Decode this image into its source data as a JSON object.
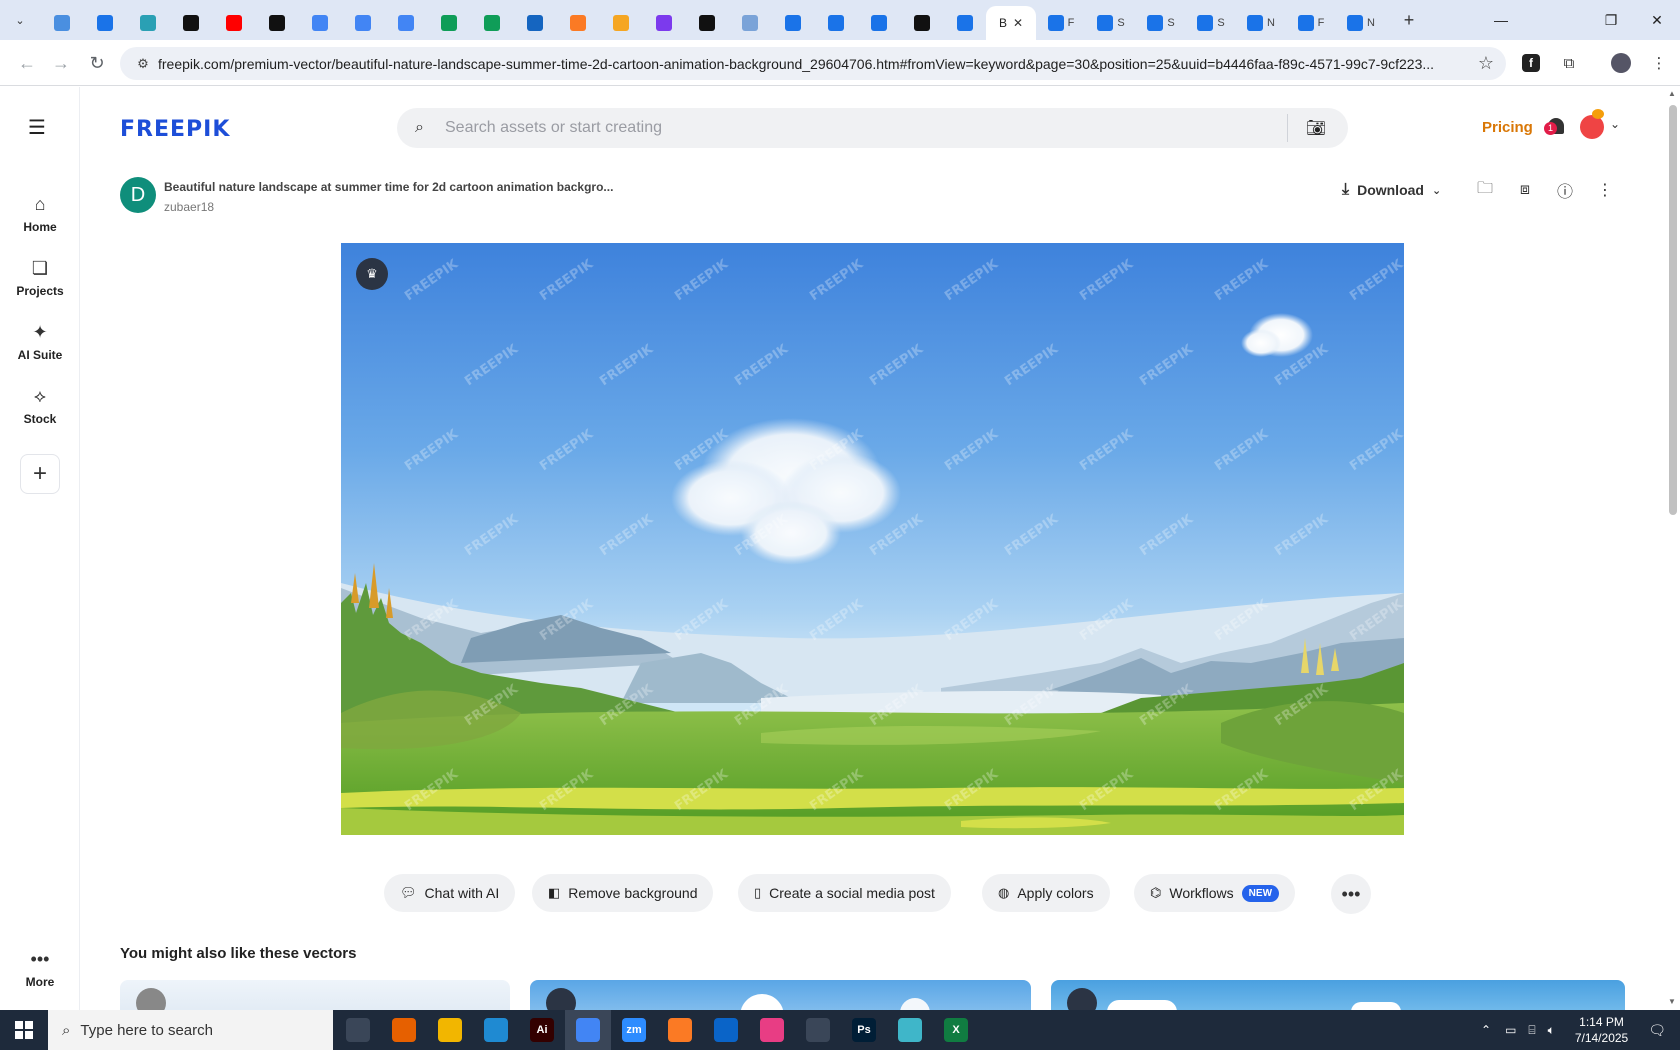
{
  "browser": {
    "tabs": [
      {
        "icon": "globe-icon",
        "color": "#4a8fe0"
      },
      {
        "icon": "shield-icon",
        "color": "#1a73e8"
      },
      {
        "icon": "play-circle-icon",
        "color": "#2aa0b4"
      },
      {
        "icon": "openai-icon",
        "color": "#111111"
      },
      {
        "icon": "youtube-icon",
        "color": "#ff0000"
      },
      {
        "icon": "bolt-icon",
        "color": "#111111"
      },
      {
        "icon": "docs-icon",
        "color": "#4285f4"
      },
      {
        "icon": "docs-icon",
        "color": "#4285f4"
      },
      {
        "icon": "docs-icon",
        "color": "#4285f4"
      },
      {
        "icon": "sheets-icon",
        "color": "#0f9d58"
      },
      {
        "icon": "sheets-icon",
        "color": "#0f9d58"
      },
      {
        "icon": "chart-icon",
        "color": "#1565c0"
      },
      {
        "icon": "xampp-icon",
        "color": "#fb7a24"
      },
      {
        "icon": "vee-icon",
        "color": "#f5a623"
      },
      {
        "icon": "braces-icon",
        "color": "#7c3aed"
      },
      {
        "icon": "artstation-icon",
        "color": "#111111"
      },
      {
        "icon": "grid-icon",
        "color": "#7aa3d8"
      },
      {
        "icon": "forms-icon",
        "color": "#1a73e8"
      },
      {
        "icon": "forms-icon",
        "color": "#1a73e8"
      },
      {
        "icon": "forms-icon",
        "color": "#1a73e8"
      },
      {
        "icon": "medium-icon",
        "color": "#111111"
      },
      {
        "icon": "forms-icon",
        "color": "#1a73e8"
      }
    ],
    "active_tab": {
      "label": "B"
    },
    "small_tabs": [
      {
        "label": "F"
      },
      {
        "label": "S"
      },
      {
        "label": "S"
      },
      {
        "label": "S"
      },
      {
        "label": "N"
      },
      {
        "label": "F"
      },
      {
        "label": "N"
      }
    ],
    "url": "freepik.com/premium-vector/beautiful-nature-landscape-summer-time-2d-cartoon-animation-background_29604706.htm#fromView=keyword&page=30&position=25&uuid=b4446faa-f89c-4571-99c7-9cf223..."
  },
  "sidebar": {
    "items": [
      {
        "label": "Home",
        "icon": "home-icon"
      },
      {
        "label": "Projects",
        "icon": "projects-icon"
      },
      {
        "label": "AI Suite",
        "icon": "sparkle-icon"
      },
      {
        "label": "Stock",
        "icon": "stock-icon"
      }
    ],
    "more_label": "More"
  },
  "header": {
    "logo": "FREEPIK",
    "search_placeholder": "Search assets or start creating",
    "pricing_label": "Pricing",
    "notification_count": "1"
  },
  "asset": {
    "author_initial": "D",
    "title": "Beautiful nature landscape at summer time for 2d cartoon animation backgro...",
    "author": "zubaer18",
    "download_label": "Download",
    "watermark_text": "FREEPIK"
  },
  "actions": [
    {
      "label": "Chat with AI",
      "icon": "chat-icon"
    },
    {
      "label": "Remove background",
      "icon": "remove-bg-icon"
    },
    {
      "label": "Create a social media post",
      "icon": "phone-icon"
    },
    {
      "label": "Apply colors",
      "icon": "palette-icon"
    },
    {
      "label": "Workflows",
      "icon": "workflow-icon",
      "badge": "NEW"
    }
  ],
  "similar": {
    "title": "You might also like these vectors"
  },
  "taskbar": {
    "search_placeholder": "Type here to search",
    "time": "1:14 PM",
    "date": "7/14/2025",
    "apps": [
      {
        "label": "",
        "color": "#3a4658",
        "icon": "task-view-icon"
      },
      {
        "label": "",
        "color": "#e66000",
        "icon": "firefox-icon"
      },
      {
        "label": "",
        "color": "#f2b600",
        "icon": "file-explorer-icon"
      },
      {
        "label": "",
        "color": "#1f8ad2",
        "icon": "vscode-icon"
      },
      {
        "label": "Ai",
        "color": "#330000",
        "icon": "illustrator-icon"
      },
      {
        "label": "",
        "color": "#4285f4",
        "icon": "chrome-icon"
      },
      {
        "label": "zm",
        "color": "#2d8cff",
        "icon": "zoom-icon"
      },
      {
        "label": "",
        "color": "#fb7a24",
        "icon": "xampp-icon"
      },
      {
        "label": "",
        "color": "#0a64c8",
        "icon": "outlook-icon"
      },
      {
        "label": "",
        "color": "#e83d84",
        "icon": "creative-cloud-icon"
      },
      {
        "label": "",
        "color": "#3a4658",
        "icon": "pen-icon"
      },
      {
        "label": "Ps",
        "color": "#001e36",
        "icon": "photoshop-icon"
      },
      {
        "label": "",
        "color": "#3fb6c9",
        "icon": "gem-icon"
      },
      {
        "label": "X",
        "color": "#107c41",
        "icon": "excel-icon"
      }
    ]
  }
}
